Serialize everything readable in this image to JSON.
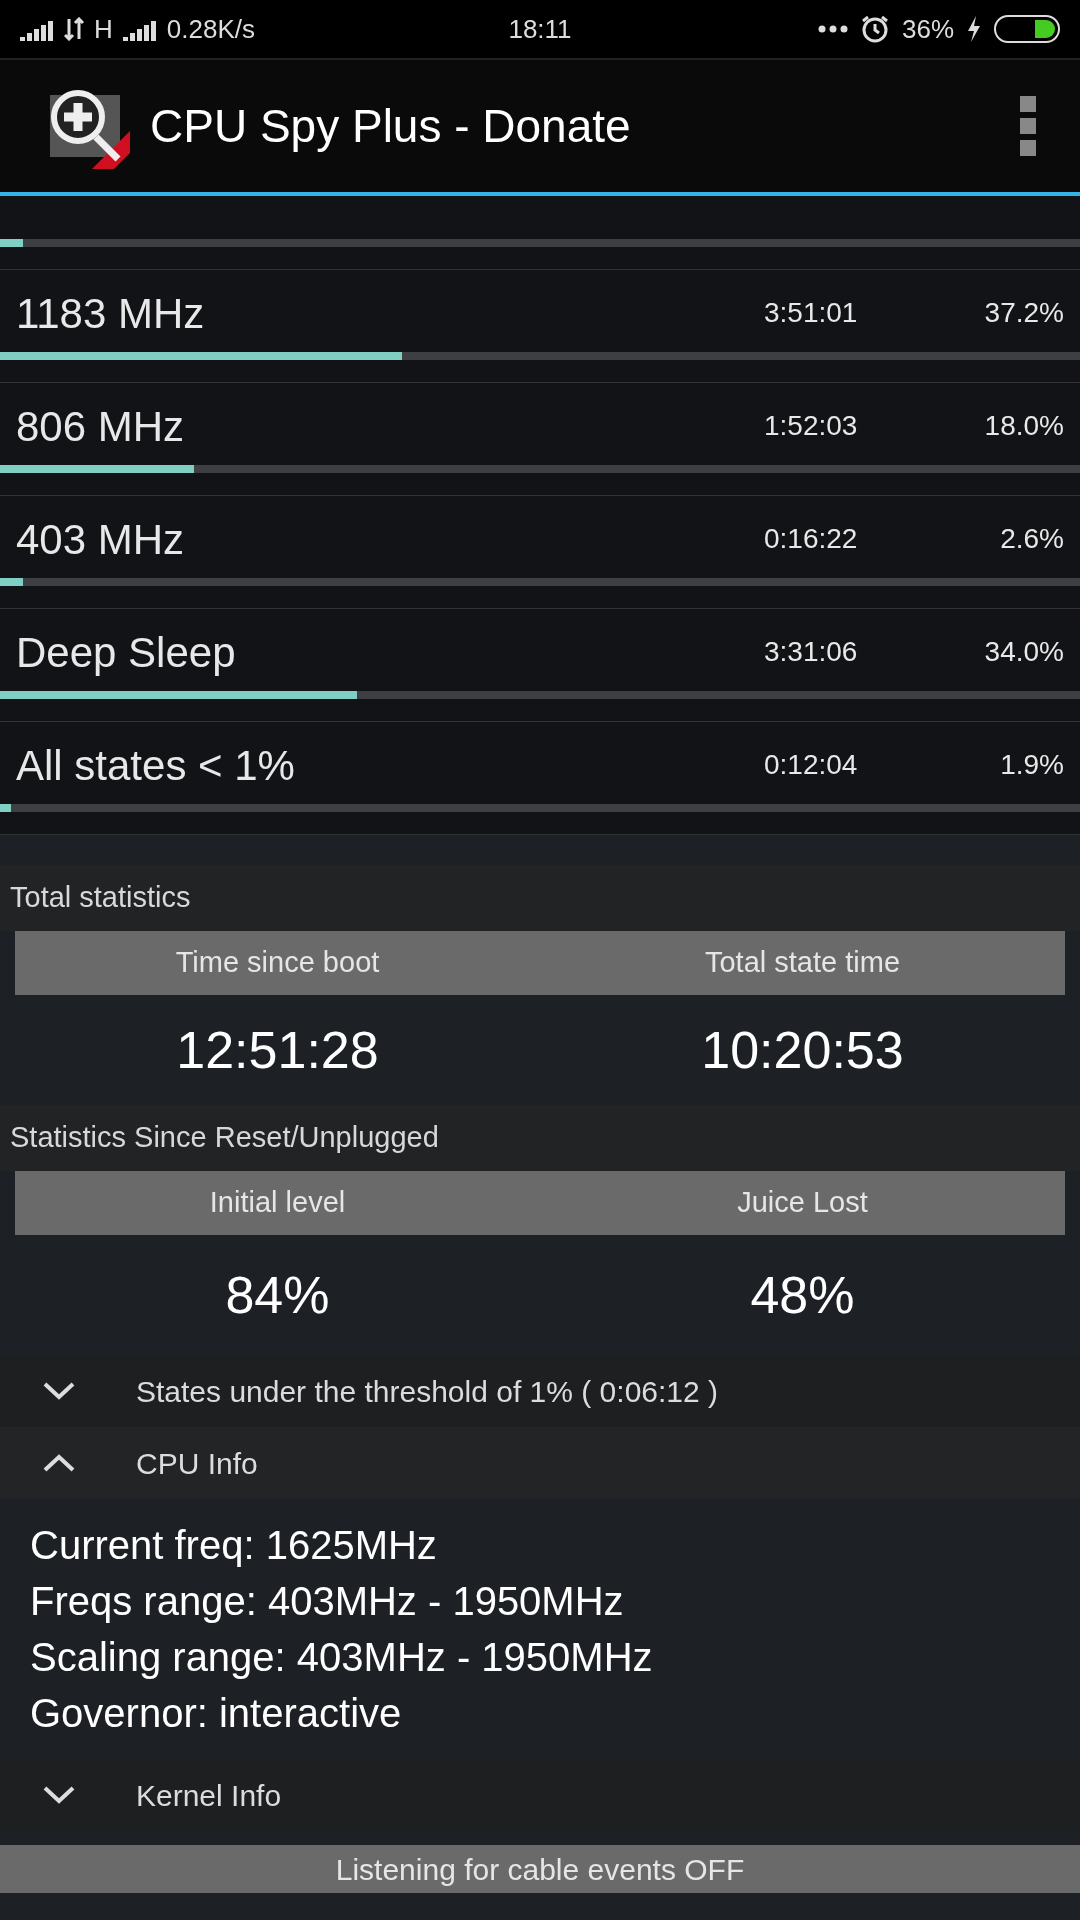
{
  "status_bar": {
    "network": "H",
    "speed": "0.28K/s",
    "time": "18:11",
    "battery": "36%"
  },
  "app_bar": {
    "title": "CPU Spy Plus - Donate"
  },
  "partial_row": {
    "level": 0.021
  },
  "states": [
    {
      "name": "1183 MHz",
      "time": "3:51:01",
      "percent": "37.2%",
      "level": 0.372
    },
    {
      "name": "806 MHz",
      "time": "1:52:03",
      "percent": "18.0%",
      "level": 0.18
    },
    {
      "name": "403 MHz",
      "time": "0:16:22",
      "percent": "2.6%",
      "level": 0.021
    },
    {
      "name": "Deep Sleep",
      "time": "3:31:06",
      "percent": "34.0%",
      "level": 0.331
    },
    {
      "name": "All states < 1%",
      "time": "0:12:04",
      "percent": "1.9%",
      "level": 0.01
    }
  ],
  "total_statistics": {
    "title": "Total statistics",
    "columns": [
      {
        "label": "Time since boot",
        "value": "12:51:28"
      },
      {
        "label": "Total state time",
        "value": "10:20:53"
      }
    ]
  },
  "reset_statistics": {
    "title": "Statistics Since Reset/Unplugged",
    "columns": [
      {
        "label": "Initial level",
        "value": "84%"
      },
      {
        "label": "Juice Lost",
        "value": "48%"
      }
    ]
  },
  "sections": [
    {
      "title": "States under the threshold of 1% ( 0:06:12 )",
      "expanded": false
    },
    {
      "title": "CPU Info",
      "expanded": true,
      "lines": [
        "Current freq: 1625MHz",
        "Freqs range: 403MHz - 1950MHz",
        "Scaling range: 403MHz - 1950MHz",
        "Governor: interactive"
      ]
    },
    {
      "title": "Kernel Info",
      "expanded": false
    }
  ],
  "footer": "Listening for cable events OFF"
}
